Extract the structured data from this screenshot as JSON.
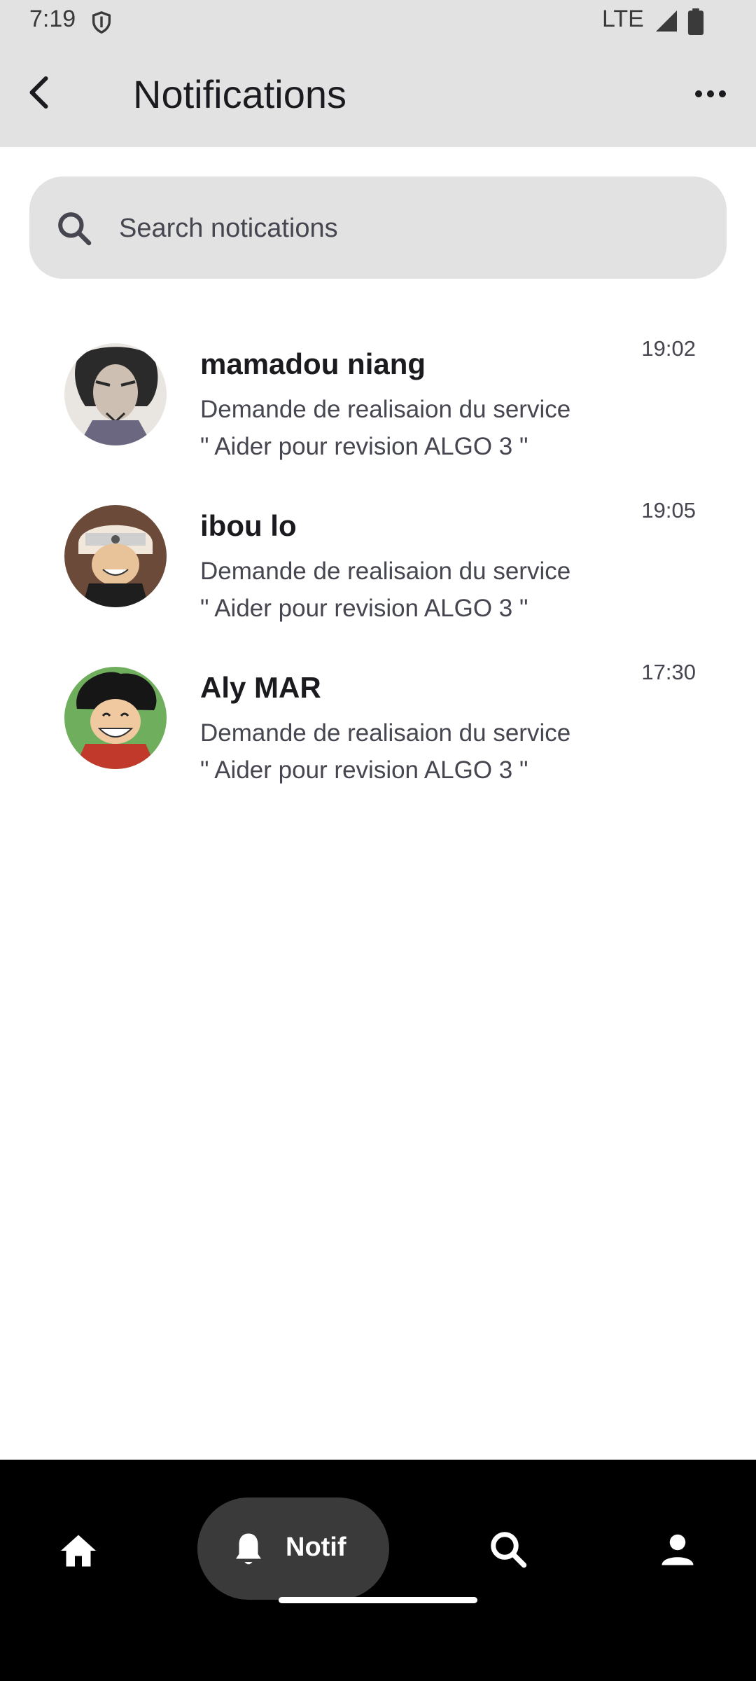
{
  "status_bar": {
    "time": "7:19",
    "network": "LTE"
  },
  "app_bar": {
    "title": "Notifications"
  },
  "search": {
    "placeholder": "Search notications"
  },
  "notifications": [
    {
      "name": "mamadou niang",
      "line1": "Demande de realisaion du service",
      "line2": "\" Aider pour revision ALGO 3 \"",
      "time": "19:02",
      "avatar": "samurai-avatar"
    },
    {
      "name": "ibou lo",
      "line1": "Demande de realisaion du service",
      "line2": "\" Aider pour revision ALGO 3 \"",
      "time": "19:05",
      "avatar": "ninja-avatar"
    },
    {
      "name": "Aly MAR",
      "line1": "Demande de realisaion du service",
      "line2": "\" Aider pour revision ALGO 3 \"",
      "time": "17:30",
      "avatar": "pirate-avatar"
    }
  ],
  "bottom_nav": {
    "active_label": "Notif",
    "items": [
      "home-icon",
      "bell-icon",
      "search-icon",
      "person-icon"
    ]
  },
  "colors": {
    "bar": "#e2e2e2",
    "nav": "#000000",
    "nav_active": "#3a3a3a"
  }
}
